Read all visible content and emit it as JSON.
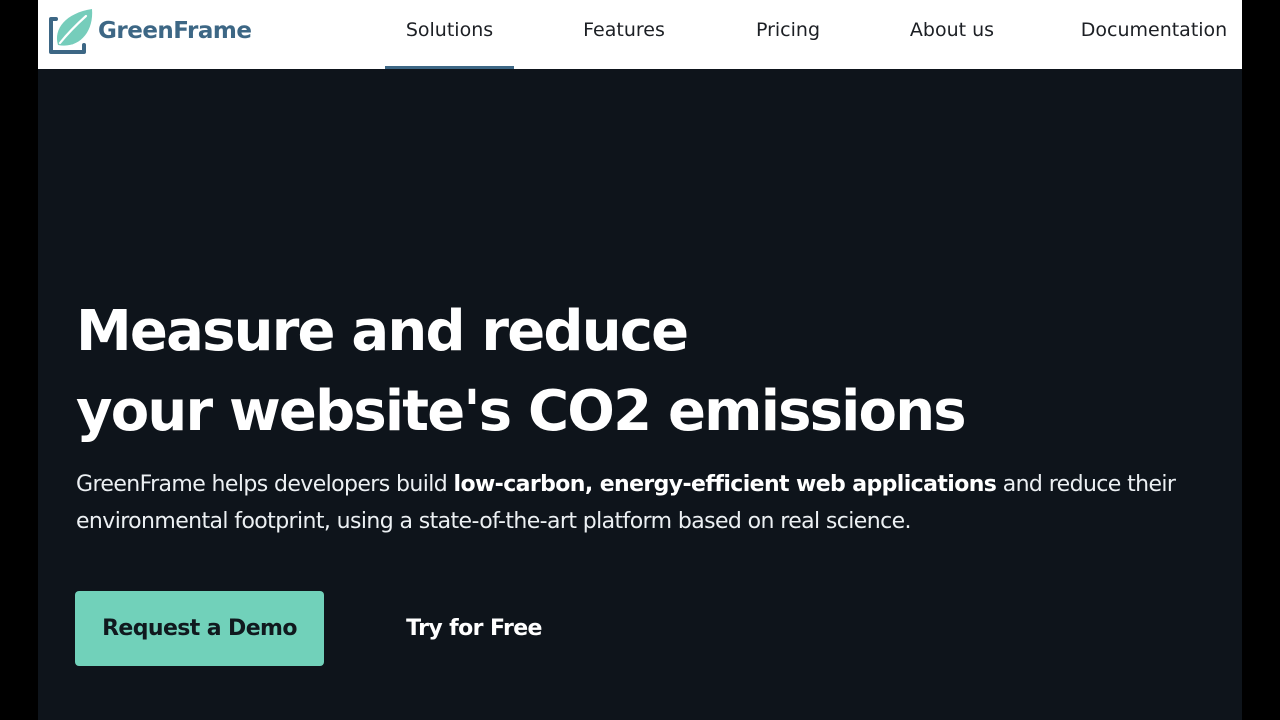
{
  "colors": {
    "hero_background": "#0e141b",
    "navbar_background": "#ffffff",
    "brand": "#3d6785",
    "brand_leaf": "#76cdbb",
    "cta_primary": "#71d1ba",
    "nav_active_underline": "#3d6785"
  },
  "brand": {
    "name": "GreenFrame",
    "icon": "leaf-frame-logo-icon"
  },
  "nav": {
    "active_index": 0,
    "items": [
      {
        "label": "Solutions"
      },
      {
        "label": "Features"
      },
      {
        "label": "Pricing"
      },
      {
        "label": "About us"
      },
      {
        "label": "Documentation"
      }
    ]
  },
  "hero": {
    "title_line_1": "Measure and reduce",
    "title_line_2": "your website's CO2 emissions",
    "subtitle_prefix": "GreenFrame helps developers build ",
    "subtitle_bold": "low-carbon, energy-efficient web applications",
    "subtitle_suffix": " and reduce their environmental footprint, using a state-of-the-art platform based on real science.",
    "primary_cta": "Request a Demo",
    "secondary_cta": "Try for Free"
  }
}
